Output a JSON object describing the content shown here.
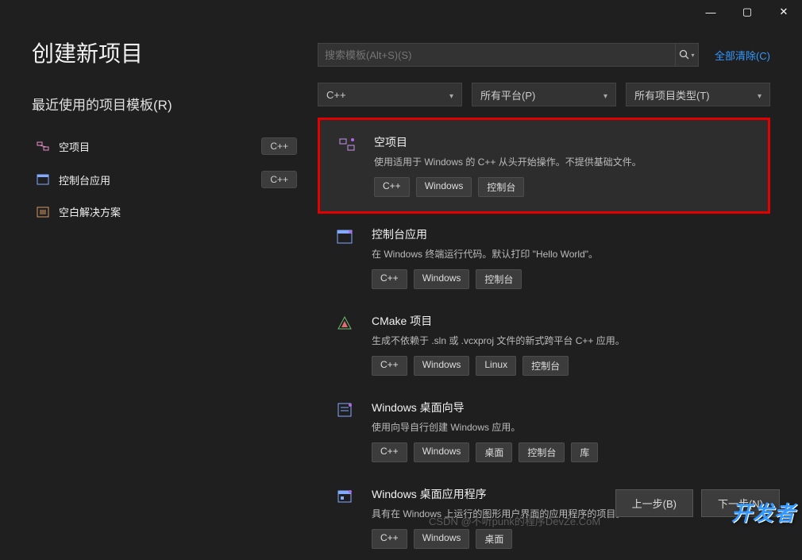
{
  "titlebar": {
    "min": "—",
    "max": "▢",
    "close": "✕"
  },
  "header": {
    "title": "创建新项目"
  },
  "recent": {
    "heading": "最近使用的项目模板(R)",
    "items": [
      {
        "label": "空项目",
        "badge": "C++"
      },
      {
        "label": "控制台应用",
        "badge": "C++"
      },
      {
        "label": "空白解决方案",
        "badge": ""
      }
    ]
  },
  "search": {
    "placeholder": "搜索模板(Alt+S)(S)",
    "clear": "全部清除(C)"
  },
  "filters": [
    {
      "label": "C++"
    },
    {
      "label": "所有平台(P)"
    },
    {
      "label": "所有项目类型(T)"
    }
  ],
  "templates": [
    {
      "title": "空项目",
      "desc": "使用适用于 Windows 的 C++ 从头开始操作。不提供基础文件。",
      "tags": [
        "C++",
        "Windows",
        "控制台"
      ],
      "highlighted": true
    },
    {
      "title": "控制台应用",
      "desc": "在 Windows 终端运行代码。默认打印 \"Hello World\"。",
      "tags": [
        "C++",
        "Windows",
        "控制台"
      ]
    },
    {
      "title": "CMake 项目",
      "desc": "生成不依赖于 .sln 或 .vcxproj 文件的新式跨平台 C++ 应用。",
      "tags": [
        "C++",
        "Windows",
        "Linux",
        "控制台"
      ]
    },
    {
      "title": "Windows 桌面向导",
      "desc": "使用向导自行创建 Windows 应用。",
      "tags": [
        "C++",
        "Windows",
        "桌面",
        "控制台",
        "库"
      ]
    },
    {
      "title": "Windows 桌面应用程序",
      "desc": "具有在 Windows 上运行的图形用户界面的应用程序的项目。",
      "tags": [
        "C++",
        "Windows",
        "桌面"
      ]
    }
  ],
  "footer": {
    "back": "上一步(B)",
    "next": "下一步(N)"
  },
  "watermark1": "CSDN @不听punk的程序DevZe.CoM",
  "watermark2": "开发者"
}
